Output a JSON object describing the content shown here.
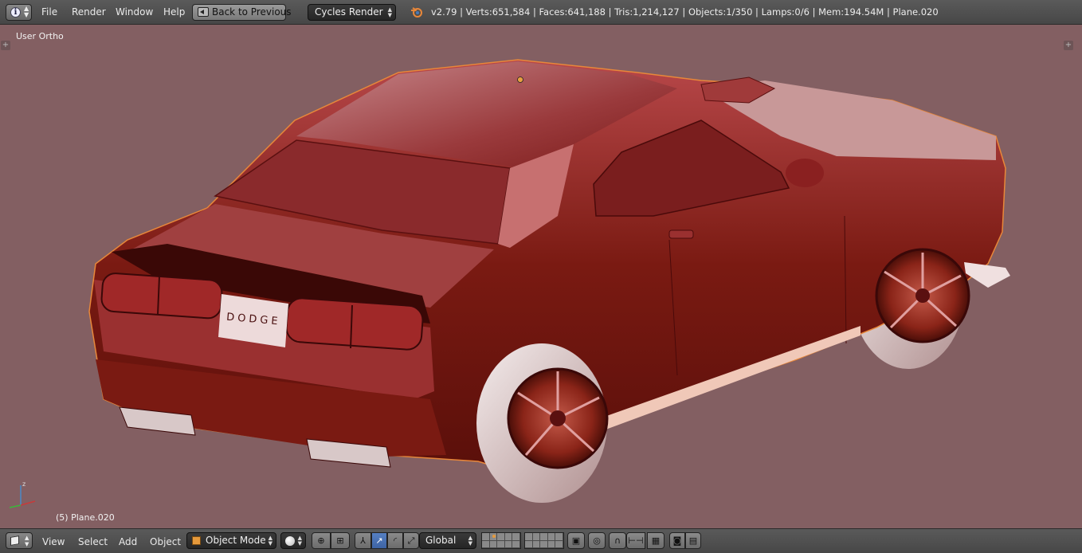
{
  "top_header": {
    "info_icon": "info-icon",
    "menus": [
      "File",
      "Render",
      "Window",
      "Help"
    ],
    "back_button": "Back to Previous",
    "render_engine": "Cycles Render",
    "stats": "v2.79 | Verts:651,584 | Faces:641,188 | Tris:1,214,127 | Objects:1/350 | Lamps:0/6 | Mem:194.54M | Plane.020"
  },
  "viewport": {
    "view_label": "User Ortho",
    "active_object_label": "(5) Plane.020",
    "background_color": "#835f62",
    "car_body_color": "#7a1a12",
    "selection_outline_color": "#e8873a",
    "plate_text": "DODGE",
    "axis_labels": {
      "z": "z",
      "x": "x",
      "y": "y"
    }
  },
  "bottom_header": {
    "editor_type_icon": "3d-view-cube-icon",
    "menus": [
      "View",
      "Select",
      "Add",
      "Object"
    ],
    "interaction_mode": "Object Mode",
    "viewport_shading_icon": "solid-sphere-icon",
    "transform_orientation": "Global"
  }
}
